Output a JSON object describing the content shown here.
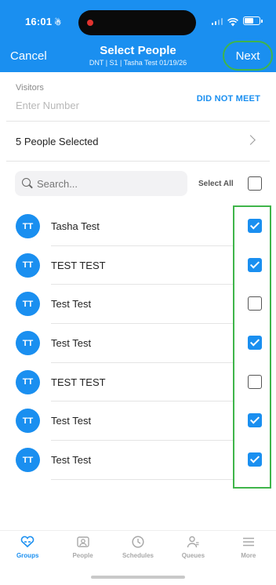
{
  "status_bar": {
    "time": "16:01",
    "time_suffix": "☃"
  },
  "header": {
    "cancel_label": "Cancel",
    "title": "Select People",
    "subtitle": "DNT | S1 | Tasha Test 01/19/26",
    "next_label": "Next"
  },
  "visitors": {
    "label": "Visitors",
    "placeholder": "Enter Number",
    "did_not_meet_label": "DID NOT MEET"
  },
  "selection_summary": "5 People Selected",
  "search": {
    "placeholder": "Search..."
  },
  "select_all_label": "Select All",
  "people": [
    {
      "initials": "TT",
      "name": "Tasha Test",
      "checked": true
    },
    {
      "initials": "TT",
      "name": "TEST TEST",
      "checked": true
    },
    {
      "initials": "TT",
      "name": "Test Test",
      "checked": false
    },
    {
      "initials": "TT",
      "name": "Test Test",
      "checked": true
    },
    {
      "initials": "TT",
      "name": "TEST TEST",
      "checked": false
    },
    {
      "initials": "TT",
      "name": "Test Test",
      "checked": true
    },
    {
      "initials": "TT",
      "name": "Test Test",
      "checked": true
    }
  ],
  "tabs": [
    {
      "label": "Groups",
      "icon": "groups-icon",
      "active": true
    },
    {
      "label": "People",
      "icon": "people-icon",
      "active": false
    },
    {
      "label": "Schedules",
      "icon": "clock-icon",
      "active": false
    },
    {
      "label": "Queues",
      "icon": "queues-icon",
      "active": false
    },
    {
      "label": "More",
      "icon": "menu-icon",
      "active": false
    }
  ],
  "colors": {
    "accent": "#1a8ff0",
    "highlight": "#3fb54a"
  }
}
